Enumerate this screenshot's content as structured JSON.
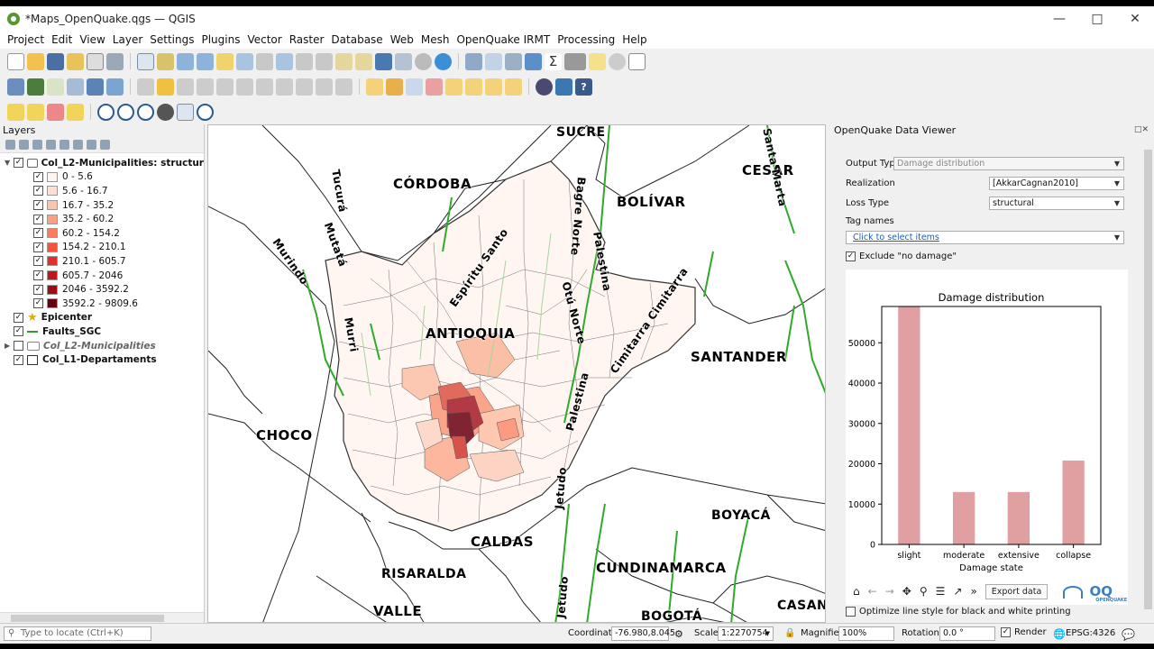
{
  "window": {
    "title": "*Maps_OpenQuake.qgs — QGIS"
  },
  "menu": [
    "Project",
    "Edit",
    "View",
    "Layer",
    "Settings",
    "Plugins",
    "Vector",
    "Raster",
    "Database",
    "Web",
    "Mesh",
    "OpenQuake IRMT",
    "Processing",
    "Help"
  ],
  "layers_panel": {
    "title": "Layers",
    "group_layer": "Col_L2-Municipalities: structur",
    "legend": [
      {
        "label": "0 - 5.6",
        "color": "#fff5f0"
      },
      {
        "label": "5.6 - 16.7",
        "color": "#fee0d2"
      },
      {
        "label": "16.7 - 35.2",
        "color": "#fcc4ad"
      },
      {
        "label": "35.2 - 60.2",
        "color": "#fca082"
      },
      {
        "label": "60.2 - 154.2",
        "color": "#fb7c5c"
      },
      {
        "label": "154.2 - 210.1",
        "color": "#f5543c"
      },
      {
        "label": "210.1 - 605.7",
        "color": "#e32f27"
      },
      {
        "label": "605.7 - 2046",
        "color": "#c1161b"
      },
      {
        "label": "2046 - 3592.2",
        "color": "#9e0d14"
      },
      {
        "label": "3592.2 - 9809.6",
        "color": "#67000d"
      }
    ],
    "other_layers": [
      {
        "name": "Epicenter",
        "checked": true,
        "style": "bold"
      },
      {
        "name": "Faults_SGC",
        "checked": true,
        "style": "bold"
      },
      {
        "name": "Col_L2-Municipalities",
        "checked": false,
        "style": "italic"
      },
      {
        "name": "Col_L1-Departaments",
        "checked": true,
        "style": "bold"
      }
    ]
  },
  "map_labels": {
    "sucre": "SUCRE",
    "cordoba": "CÓRDOBA",
    "bolivar": "BOLÍVAR",
    "cesar": "CESAR",
    "santa_marta": "Santa Marta",
    "tucura": "Tucurá",
    "mutata": "Mutatá",
    "murindo": "Murindo",
    "espiritu_santo": "Espíritu Santo",
    "bagre_norte": "Bagre Norte",
    "palestina1": "Palestina",
    "otu_norte": "Otú Norte",
    "cimitarra": "Cimitarra Cimitarra",
    "murri": "Murri",
    "antioquia": "ANTIOQUIA",
    "santander": "SANTANDER",
    "palestina2": "Palestina",
    "choco": "CHOCO",
    "jetudo1": "Jetudo",
    "boyaca": "BOYACÁ",
    "caldas": "CALDAS",
    "risaralda": "RISARALDA",
    "cundinamarca": "CUNDINAMARCA",
    "jetudo2": "Jetudo",
    "valle": "VALLE",
    "bogota": "BOGOTÁ",
    "casan": "CASAN"
  },
  "oq_panel": {
    "title": "OpenQuake Data Viewer",
    "output_type_label": "Output Type",
    "output_type_value": "Damage distribution",
    "realization_label": "Realization",
    "realization_value": "[AkkarCagnan2010]",
    "loss_type_label": "Loss Type",
    "loss_type_value": "structural",
    "tag_names_label": "Tag names",
    "tag_select_link": "Click to select items",
    "exclude_label": "Exclude \"no damage\"",
    "export_button": "Export data",
    "optimize_label": "Optimize line style for black and white printing",
    "logo_text": "OQ",
    "logo_sub": "OPENQUAKE"
  },
  "chart_data": {
    "type": "bar",
    "title": "Damage distribution",
    "xlabel": "Damage state",
    "ylabel": "",
    "categories": [
      "slight",
      "moderate",
      "extensive",
      "collapse"
    ],
    "values": [
      59000,
      13000,
      13000,
      20800
    ],
    "ylim": [
      0,
      59000
    ],
    "yticks": [
      0,
      10000,
      20000,
      30000,
      40000,
      50000
    ],
    "bar_color": "#e0a0a2",
    "grid": false
  },
  "status": {
    "locate_placeholder": "Type to locate (Ctrl+K)",
    "coordinate_label": "Coordinate",
    "coordinate_value": "-76.980,8.045",
    "scale_label": "Scale",
    "scale_value": "1:2270754",
    "magnifier_label": "Magnifier",
    "magnifier_value": "100%",
    "rotation_label": "Rotation",
    "rotation_value": "0.0 °",
    "render_label": "Render",
    "crs": "EPSG:4326"
  }
}
